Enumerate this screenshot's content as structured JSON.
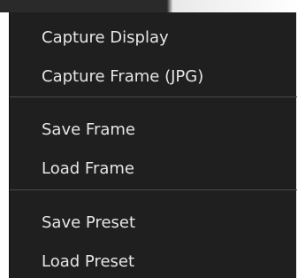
{
  "context_menu": {
    "items": [
      {
        "label": "Capture Display"
      },
      {
        "label": "Capture Frame (JPG)"
      },
      {
        "label": "Save Frame"
      },
      {
        "label": "Load Frame"
      },
      {
        "label": "Save Preset"
      },
      {
        "label": "Load Preset"
      }
    ]
  },
  "colors": {
    "menu_background": "#1f1f1f",
    "menu_text": "#e6e6e6",
    "separator": "#4a4a4a"
  }
}
